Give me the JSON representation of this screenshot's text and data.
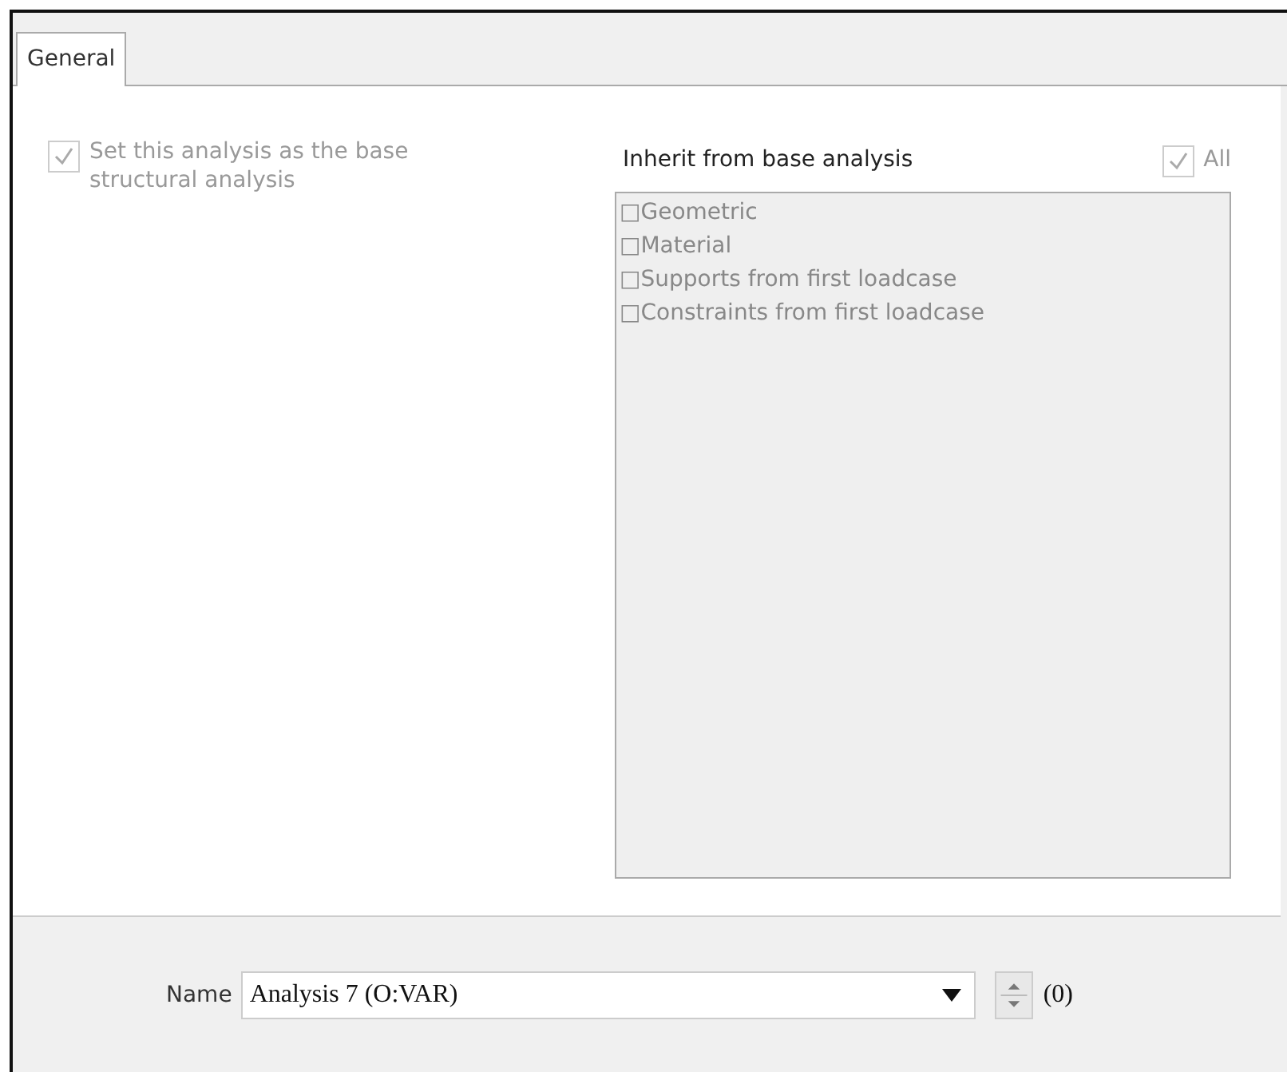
{
  "tabs": [
    {
      "label": "General",
      "selected": true
    }
  ],
  "base_analysis": {
    "label": "Set this analysis as the base structural analysis",
    "checked": true,
    "disabled": true
  },
  "inherit": {
    "heading": "Inherit from base analysis",
    "all": {
      "label": "All",
      "checked": true,
      "disabled": true
    },
    "items": [
      {
        "label": "□Geometric"
      },
      {
        "label": "□Material"
      },
      {
        "label": "□Supports from first loadcase"
      },
      {
        "label": "□Constraints from first loadcase"
      }
    ]
  },
  "name": {
    "label": "Name",
    "value": "Analysis 7 (O:VAR)",
    "counter": "(0)"
  }
}
